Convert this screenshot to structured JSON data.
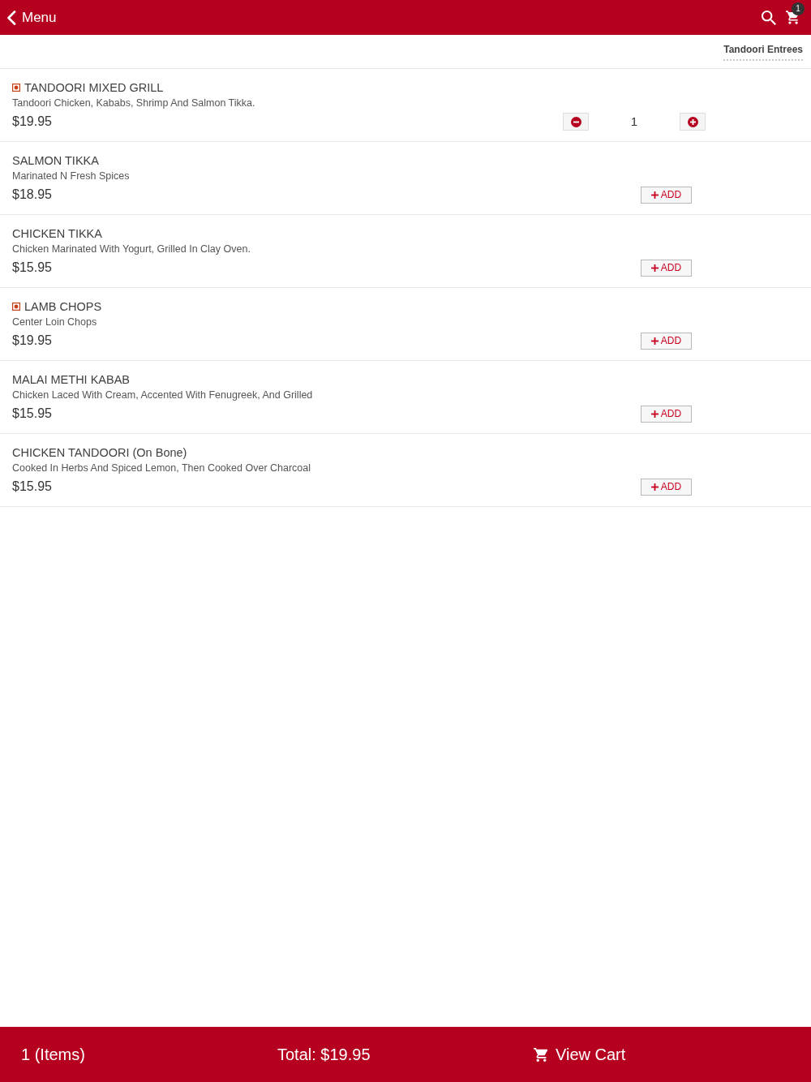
{
  "header": {
    "back_label": "Menu",
    "cart_count": "1"
  },
  "category_tabs": [
    {
      "label": "Tandoori Entrees",
      "selected": true
    }
  ],
  "items": [
    {
      "name": "TANDOORI MIXED GRILL",
      "description": "Tandoori Chicken, Kababs, Shrimp And Salmon Tikka.",
      "price": "$19.95",
      "special": true,
      "kind": "stepper",
      "quantity": "1"
    },
    {
      "name": "SALMON TIKKA",
      "description": "Marinated N Fresh Spices",
      "price": "$18.95",
      "special": false,
      "kind": "add",
      "add_label": "ADD"
    },
    {
      "name": "CHICKEN TIKKA",
      "description": "Chicken Marinated With Yogurt, Grilled In Clay Oven.",
      "price": "$15.95",
      "special": false,
      "kind": "add",
      "add_label": "ADD"
    },
    {
      "name": "LAMB CHOPS",
      "description": "Center Loin Chops",
      "price": "$19.95",
      "special": true,
      "kind": "add",
      "add_label": "ADD"
    },
    {
      "name": "MALAI METHI KABAB",
      "description": "Chicken Laced With Cream, Accented With Fenugreek, And Grilled",
      "price": "$15.95",
      "special": false,
      "kind": "add",
      "add_label": "ADD"
    },
    {
      "name": "CHICKEN TANDOORI (On Bone)",
      "description": "Cooked In Herbs And Spiced Lemon, Then Cooked Over Charcoal",
      "price": "$15.95",
      "special": false,
      "kind": "add",
      "add_label": "ADD"
    }
  ],
  "footer": {
    "items_count": "1 (Items)",
    "total": "Total: $19.95",
    "view_cart": "View Cart"
  }
}
